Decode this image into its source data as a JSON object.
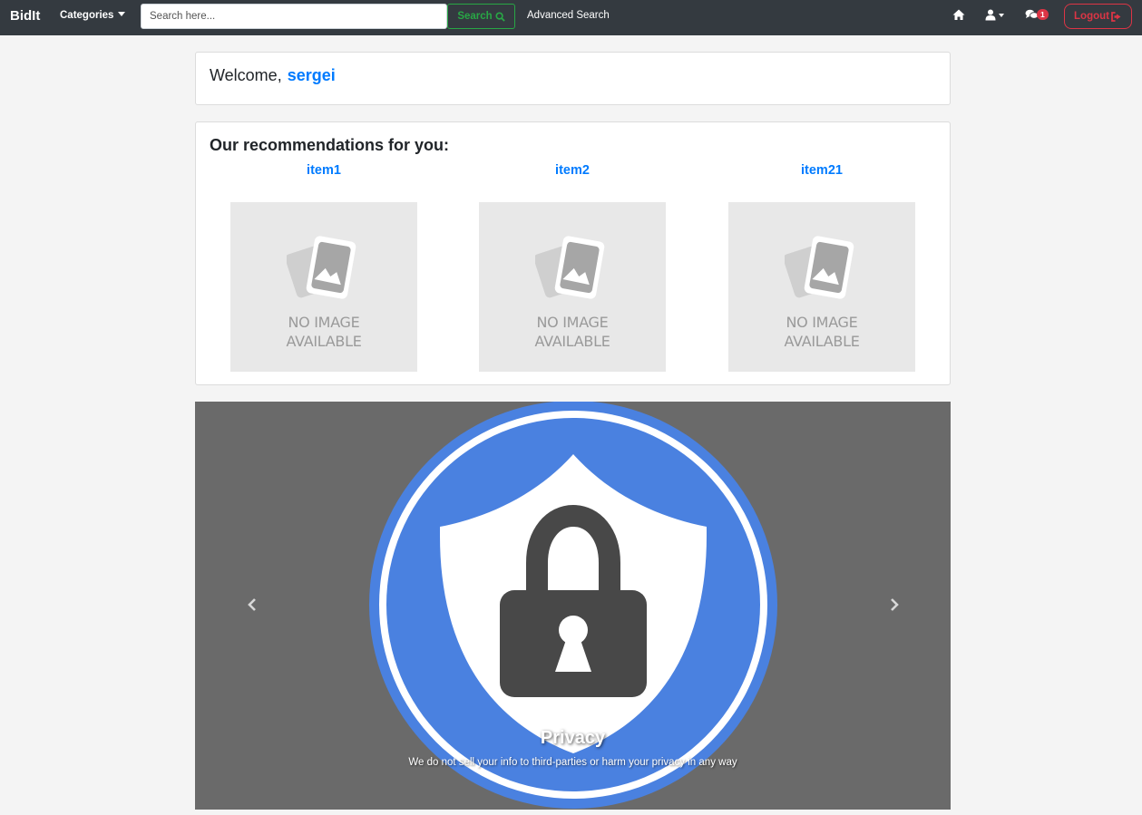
{
  "navbar": {
    "brand": "BidIt",
    "categories_label": "Categories",
    "search_placeholder": "Search here...",
    "search_label": "Search",
    "advanced_search_label": "Advanced Search",
    "messages_count": "1",
    "logout_label": "Logout"
  },
  "welcome": {
    "greeting": "Welcome,",
    "username": "sergei"
  },
  "recommendations": {
    "title": "Our recommendations for you:",
    "no_image_line1": "NO IMAGE",
    "no_image_line2": "AVAILABLE",
    "items": [
      {
        "name": "item1"
      },
      {
        "name": "item2"
      },
      {
        "name": "item21"
      }
    ]
  },
  "carousel": {
    "caption_title": "Privacy",
    "caption_text": "We do not sell your info to third-parties or harm your privacy in any way"
  },
  "colors": {
    "navbar_bg": "#343a40",
    "link": "#007bff",
    "success": "#28a745",
    "danger": "#dc3545",
    "shield_blue": "#4a81e0",
    "lock_gray": "#484848"
  },
  "icons": [
    "home-icon",
    "user-icon",
    "comments-icon",
    "sign-out-icon",
    "search-icon",
    "chevron-left-icon",
    "chevron-right-icon",
    "lock-icon",
    "shield-icon"
  ]
}
